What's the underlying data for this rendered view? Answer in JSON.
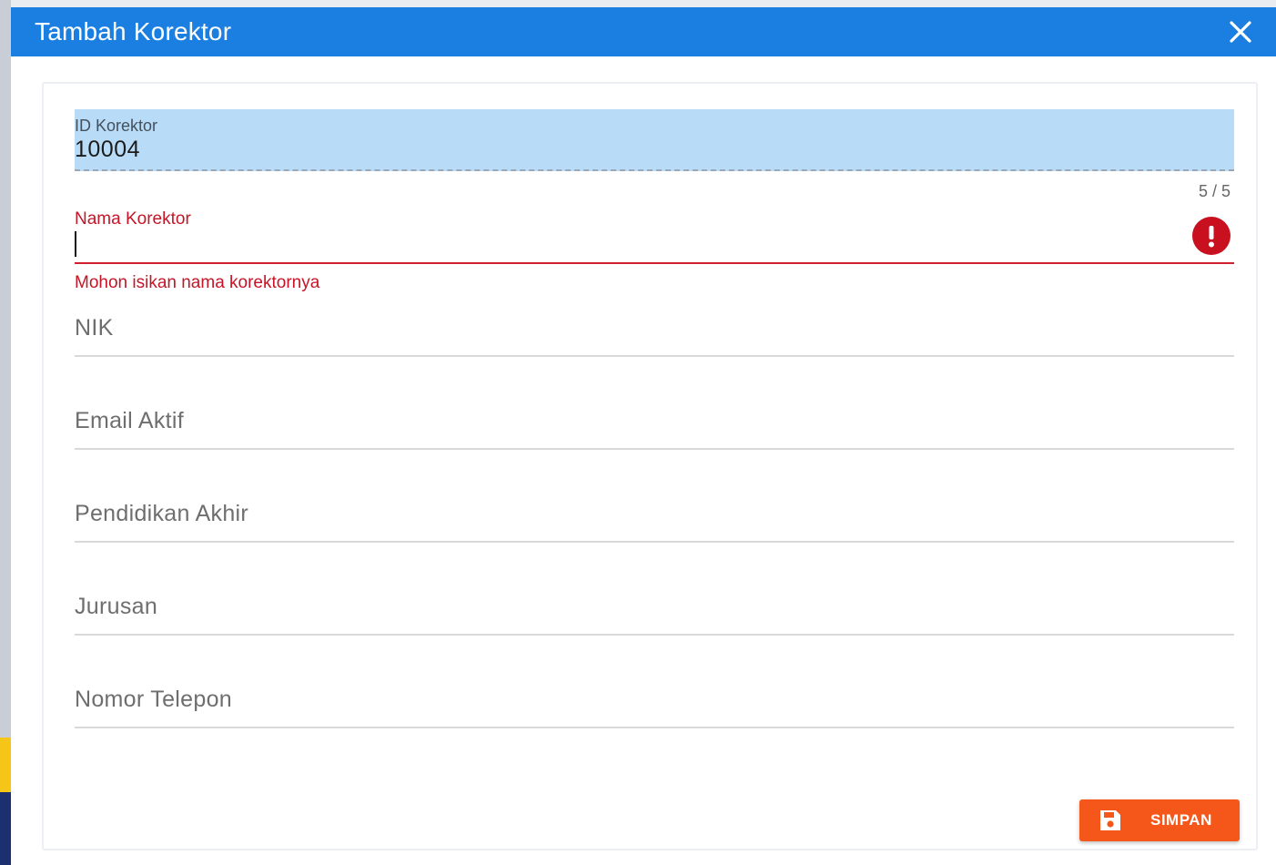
{
  "dialog": {
    "title": "Tambah Korektor",
    "close_icon": "close-icon"
  },
  "form": {
    "id_field": {
      "label": "ID Korektor",
      "value": "10004",
      "counter": "5 / 5"
    },
    "name_field": {
      "label": "Nama Korektor",
      "value": "",
      "error": "Mohon isikan nama korektornya",
      "error_icon": "exclamation-circle-icon"
    },
    "fields": [
      {
        "label": "NIK"
      },
      {
        "label": "Email Aktif"
      },
      {
        "label": "Pendidikan Akhir"
      },
      {
        "label": "Jurusan"
      },
      {
        "label": "Nomor Telepon"
      }
    ]
  },
  "actions": {
    "save_label": "SIMPAN",
    "save_icon": "floppy-disk-icon"
  },
  "colors": {
    "header": "#1a7fe0",
    "error": "#c8101f",
    "save_button": "#f5571a",
    "filled_field": "#b8dcf7"
  }
}
